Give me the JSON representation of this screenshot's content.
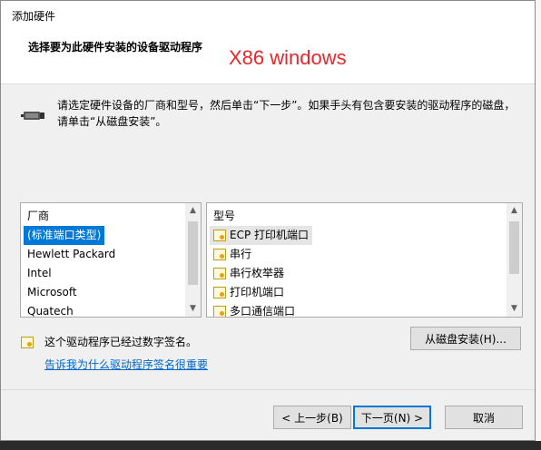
{
  "window": {
    "title": "添加硬件"
  },
  "header": {
    "heading": "选择要为此硬件安装的设备驱动程序",
    "annotation": "X86 windows",
    "annotation_color": "#e8262b"
  },
  "intro": {
    "line1": "请选定硬件设备的厂商和型号，然后单击“下一步”。如果手头有包含要安装的驱动程序的磁盘，",
    "line2": "请单击“从磁盘安装”。",
    "icon": "connector-icon"
  },
  "manufacturers": {
    "header": "厂商",
    "items": [
      {
        "label": "(标准端口类型)",
        "selected": true
      },
      {
        "label": "Hewlett Packard",
        "selected": false
      },
      {
        "label": "Intel",
        "selected": false
      },
      {
        "label": "Microsoft",
        "selected": false
      },
      {
        "label": "Quatech",
        "selected": false
      }
    ]
  },
  "models": {
    "header": "型号",
    "items": [
      {
        "label": "ECP 打印机端口",
        "focused": true,
        "icon": "certificate-icon"
      },
      {
        "label": "串行",
        "focused": false,
        "icon": "certificate-icon"
      },
      {
        "label": "串行枚举器",
        "focused": false,
        "icon": "certificate-icon"
      },
      {
        "label": "打印机端口",
        "focused": false,
        "icon": "certificate-icon"
      },
      {
        "label": "多口通信端口",
        "focused": false,
        "icon": "certificate-icon"
      }
    ]
  },
  "signature": {
    "text": "这个驱动程序已经过数字签名。",
    "link": "告诉我为什么驱动程序签名很重要",
    "icon": "certificate-icon"
  },
  "buttons": {
    "have_disk": "从磁盘安装(H)...",
    "back": "< 上一步(B)",
    "next": "下一页(N) >",
    "cancel": "取消"
  },
  "colors": {
    "selection": "#0078d7",
    "link": "#0066cc",
    "dialog_bg": "#f0f0f0"
  }
}
